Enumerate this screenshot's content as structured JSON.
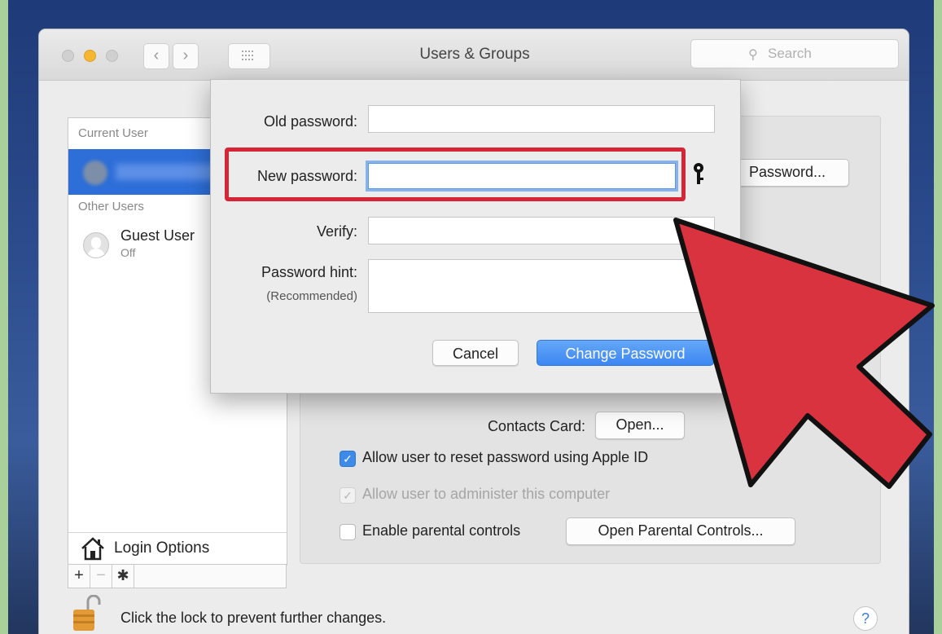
{
  "window": {
    "title": "Users & Groups",
    "search_placeholder": "Search",
    "nav_back": "‹",
    "nav_forward": "›"
  },
  "sidebar": {
    "current_user_header": "Current User",
    "other_users_header": "Other Users",
    "guest": {
      "name": "Guest User",
      "status": "Off"
    },
    "login_options_label": "Login Options",
    "add_label": "+",
    "remove_label": "−",
    "action_label": "✱"
  },
  "detail": {
    "change_password_button": "Password...",
    "contacts_card_label": "Contacts Card:",
    "open_button": "Open...",
    "allow_reset_label": "Allow user to reset password using Apple ID",
    "allow_reset_checked": true,
    "allow_admin_label": "Allow user to administer this computer",
    "allow_admin_checked": true,
    "allow_admin_disabled": true,
    "parental_label": "Enable parental controls",
    "parental_checked": false,
    "open_parental_button": "Open Parental Controls..."
  },
  "sheet": {
    "old_password_label": "Old password:",
    "old_password_value": "",
    "new_password_label": "New password:",
    "new_password_value": "",
    "verify_label": "Verify:",
    "verify_value": "",
    "hint_label": "Password hint:",
    "hint_sublabel": "(Recommended)",
    "hint_value": "",
    "cancel_button": "Cancel",
    "change_button": "Change Password"
  },
  "status": {
    "lock_text": "Click the lock to prevent further changes.",
    "help_label": "?"
  },
  "colors": {
    "highlight": "#d62536",
    "accent": "#3b86f1",
    "background": "#a9cf9a"
  }
}
